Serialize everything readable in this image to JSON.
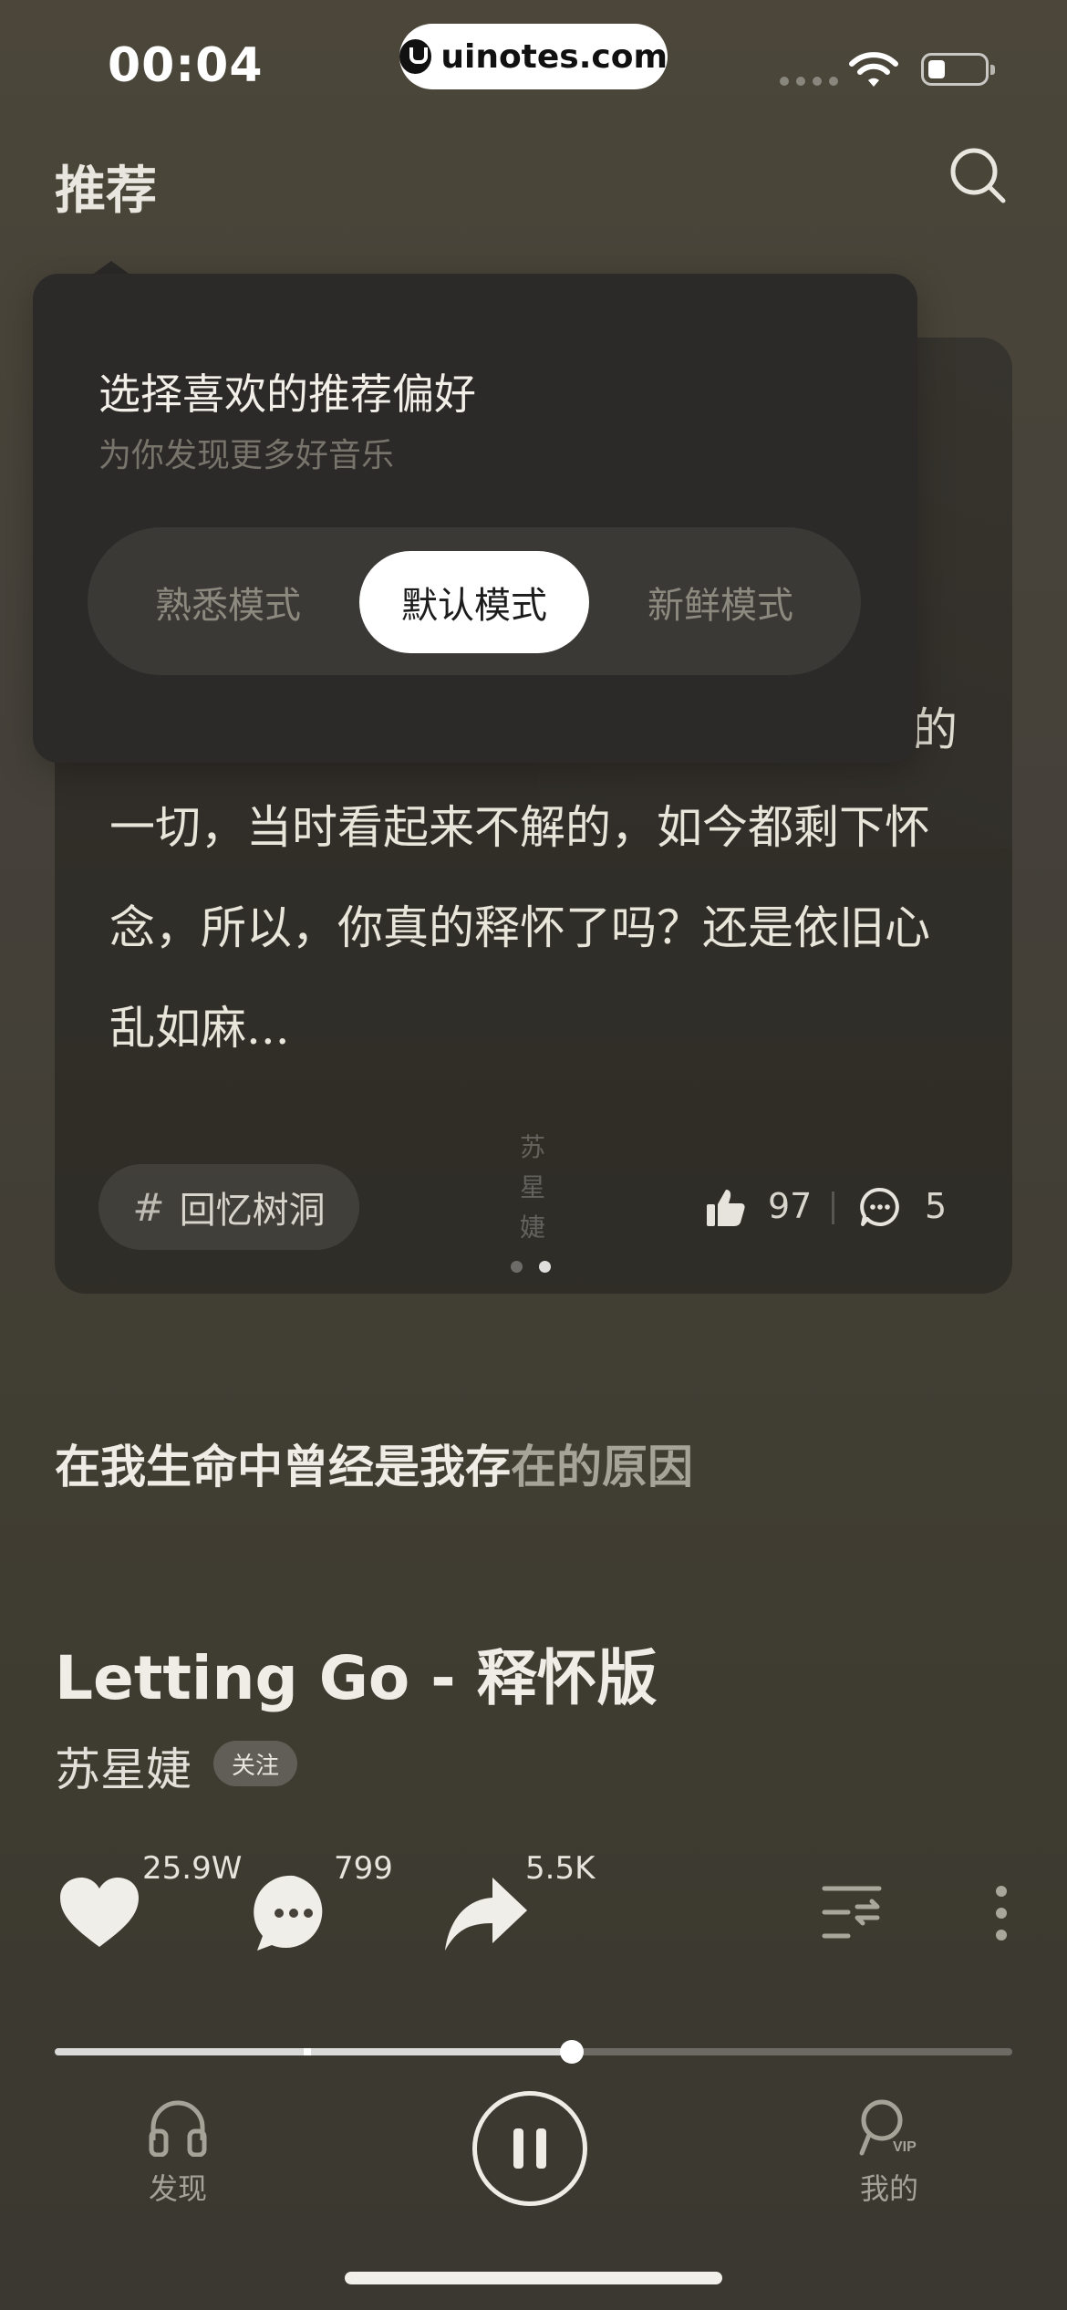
{
  "status_bar": {
    "time": "00:04",
    "url": "uinotes.com",
    "battery_level": 0.3
  },
  "header": {
    "title": "推荐",
    "search_icon": "search-icon"
  },
  "preference_popover": {
    "title": "选择喜欢的推荐偏好",
    "subtitle": "为你发现更多好音乐",
    "modes": [
      "熟悉模式",
      "默认模式",
      "新鲜模式"
    ],
    "selected_mode": "默认模式"
  },
  "story_card": {
    "partial_text": "的",
    "text": "一切，当时看起来不解的，如今都剩下怀念，所以，你真的释怀了吗？还是依旧心乱如麻...",
    "topic": "回忆树洞",
    "artist_vertical": "苏星婕",
    "likes": "97",
    "comments": "5",
    "page_count": 2,
    "current_page": 2
  },
  "lyric": {
    "sung": "在我生命中曾经是我存",
    "upcoming": "在的原因"
  },
  "song": {
    "title": "Letting Go - 释怀版",
    "artist": "苏星婕",
    "follow_label": "关注",
    "likes": "25.9W",
    "comments": "799",
    "shares": "5.5K"
  },
  "player": {
    "progress": 0.54,
    "buffer_marker": 0.26,
    "state": "playing"
  },
  "tab_bar": {
    "discover_label": "发现",
    "mine_label": "我的"
  },
  "colors": {
    "background": "#47433a",
    "popover": "#2b2a28",
    "accent_text": "#ffffff"
  }
}
